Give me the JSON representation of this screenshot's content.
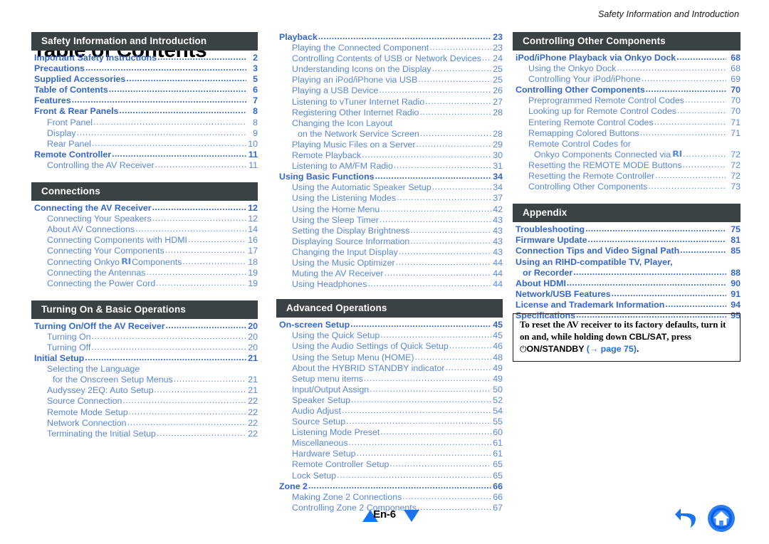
{
  "running_header": "Safety Information and Introduction",
  "page_title": "Table of Contents",
  "columns": [
    {
      "id": "column-1",
      "sections": [
        {
          "header": "Safety Information and Introduction",
          "entries": [
            {
              "level": 1,
              "label": "Important Safety Instructions",
              "page": "2"
            },
            {
              "level": 1,
              "label": "Precautions",
              "page": "3"
            },
            {
              "level": 1,
              "label": "Supplied Accessories",
              "page": "5"
            },
            {
              "level": 1,
              "label": "Table of Contents",
              "page": "6"
            },
            {
              "level": 1,
              "label": "Features",
              "page": "7"
            },
            {
              "level": 1,
              "label": "Front & Rear Panels",
              "page": "8"
            },
            {
              "level": 2,
              "label": "Front Panel",
              "page": "8"
            },
            {
              "level": 2,
              "label": "Display",
              "page": "9"
            },
            {
              "level": 2,
              "label": "Rear Panel",
              "page": "10"
            },
            {
              "level": 1,
              "label": "Remote Controller",
              "page": "11"
            },
            {
              "level": 2,
              "label": "Controlling the AV Receiver",
              "page": "11"
            }
          ]
        },
        {
          "header": "Connections",
          "entries": [
            {
              "level": 1,
              "label": "Connecting the AV Receiver",
              "page": "12"
            },
            {
              "level": 2,
              "label": "Connecting Your Speakers",
              "page": "12"
            },
            {
              "level": 2,
              "label": "About AV Connections",
              "page": "14"
            },
            {
              "level": 2,
              "label": "Connecting Components with HDMI",
              "page": "16"
            },
            {
              "level": 2,
              "label": "Connecting Your Components",
              "page": "17"
            },
            {
              "level": 2,
              "label": "Connecting Onkyo ",
              "logo": "RI",
              "label_after": " Components",
              "page": "18"
            },
            {
              "level": 2,
              "label": "Connecting the Antennas",
              "page": "19"
            },
            {
              "level": 2,
              "label": "Connecting the Power Cord",
              "page": "19"
            }
          ]
        },
        {
          "header": "Turning On & Basic Operations",
          "entries": [
            {
              "level": 1,
              "label": "Turning On/Off the AV Receiver",
              "page": "20"
            },
            {
              "level": 2,
              "label": "Turning On",
              "page": "20"
            },
            {
              "level": 2,
              "label": "Turning Off",
              "page": "20"
            },
            {
              "level": 1,
              "label": "Initial Setup",
              "page": "21"
            },
            {
              "level": 2,
              "label": "Selecting the Language",
              "page": "",
              "nodots": true
            },
            {
              "level": 3,
              "label": "for the Onscreen Setup Menus",
              "page": "21"
            },
            {
              "level": 2,
              "label": "Audyssey 2EQ: Auto Setup",
              "page": "21"
            },
            {
              "level": 2,
              "label": "Source Connection",
              "page": "22"
            },
            {
              "level": 2,
              "label": "Remote Mode Setup",
              "page": "22"
            },
            {
              "level": 2,
              "label": "Network Connection",
              "page": "22"
            },
            {
              "level": 2,
              "label": "Terminating the Initial Setup",
              "page": "22"
            }
          ]
        }
      ]
    },
    {
      "id": "column-2",
      "sections": [
        {
          "header": null,
          "entries": [
            {
              "level": 1,
              "label": "Playback",
              "page": "23"
            },
            {
              "level": 2,
              "label": "Playing the Connected Component",
              "page": "23"
            },
            {
              "level": 2,
              "label": "Controlling Contents of USB or Network Devices",
              "page": "24"
            },
            {
              "level": 2,
              "label": "Understanding Icons on the Display",
              "page": "25"
            },
            {
              "level": 2,
              "label": "Playing an iPod/iPhone via USB",
              "page": "25"
            },
            {
              "level": 2,
              "label": "Playing a USB Device",
              "page": "26"
            },
            {
              "level": 2,
              "label": "Listening to vTuner Internet Radio",
              "page": "27"
            },
            {
              "level": 2,
              "label": "Registering Other Internet Radio",
              "page": "28"
            },
            {
              "level": 2,
              "label": "Changing the Icon Layout",
              "page": "",
              "nodots": true
            },
            {
              "level": 3,
              "label": "on the Network Service Screen",
              "page": "28"
            },
            {
              "level": 2,
              "label": "Playing Music Files on a Server",
              "page": "29"
            },
            {
              "level": 2,
              "label": "Remote Playback",
              "page": "30"
            },
            {
              "level": 2,
              "label": "Listening to AM/FM Radio",
              "page": "31"
            },
            {
              "level": 1,
              "label": "Using Basic Functions",
              "page": "34"
            },
            {
              "level": 2,
              "label": "Using the Automatic Speaker Setup",
              "page": "34"
            },
            {
              "level": 2,
              "label": "Using the Listening Modes",
              "page": "37"
            },
            {
              "level": 2,
              "label": "Using the Home Menu",
              "page": "42"
            },
            {
              "level": 2,
              "label": "Using the Sleep Timer",
              "page": "43"
            },
            {
              "level": 2,
              "label": "Setting the Display Brightness",
              "page": "43"
            },
            {
              "level": 2,
              "label": "Displaying Source Information",
              "page": "43"
            },
            {
              "level": 2,
              "label": "Changing the Input Display",
              "page": "43"
            },
            {
              "level": 2,
              "label": "Using the Music Optimizer",
              "page": "44"
            },
            {
              "level": 2,
              "label": "Muting the AV Receiver",
              "page": "44"
            },
            {
              "level": 2,
              "label": "Using Headphones",
              "page": "44"
            }
          ]
        },
        {
          "header": "Advanced Operations",
          "entries": [
            {
              "level": 1,
              "label": "On-screen Setup",
              "page": "45"
            },
            {
              "level": 2,
              "label": "Using the Quick Setup",
              "page": "45"
            },
            {
              "level": 2,
              "label": "Using the Audio Settings of Quick Setup",
              "page": "46"
            },
            {
              "level": 2,
              "label": "Using the Setup Menu (HOME)",
              "page": "48"
            },
            {
              "level": 2,
              "label": "About the HYBRID STANDBY indicator",
              "page": "49"
            },
            {
              "level": 2,
              "label": "Setup menu items",
              "page": "49"
            },
            {
              "level": 2,
              "label": "Input/Output Assign",
              "page": "50"
            },
            {
              "level": 2,
              "label": "Speaker Setup",
              "page": "52"
            },
            {
              "level": 2,
              "label": "Audio Adjust",
              "page": "54"
            },
            {
              "level": 2,
              "label": "Source Setup",
              "page": "55"
            },
            {
              "level": 2,
              "label": "Listening Mode Preset",
              "page": "60"
            },
            {
              "level": 2,
              "label": "Miscellaneous",
              "page": "61"
            },
            {
              "level": 2,
              "label": "Hardware Setup",
              "page": "61"
            },
            {
              "level": 2,
              "label": "Remote Controller Setup",
              "page": "65"
            },
            {
              "level": 2,
              "label": "Lock Setup",
              "page": "65"
            },
            {
              "level": 1,
              "label": "Zone 2",
              "page": "66"
            },
            {
              "level": 2,
              "label": "Making Zone 2 Connections",
              "page": "66"
            },
            {
              "level": 2,
              "label": "Controlling Zone 2 Components",
              "page": "67"
            }
          ]
        }
      ]
    },
    {
      "id": "column-3",
      "sections": [
        {
          "header": "Controlling Other Components",
          "entries": [
            {
              "level": 1,
              "label": "iPod/iPhone Playback via Onkyo Dock",
              "page": "68"
            },
            {
              "level": 2,
              "label": "Using the Onkyo Dock",
              "page": "68"
            },
            {
              "level": 2,
              "label": "Controlling Your iPod/iPhone",
              "page": "69"
            },
            {
              "level": 1,
              "label": "Controlling Other Components",
              "page": "70"
            },
            {
              "level": 2,
              "label": "Preprogrammed Remote Control Codes",
              "page": "70"
            },
            {
              "level": 2,
              "label": "Looking up for Remote Control Codes",
              "page": "70"
            },
            {
              "level": 2,
              "label": "Entering Remote Control Codes",
              "page": "71"
            },
            {
              "level": 2,
              "label": "Remapping Colored Buttons",
              "page": "71"
            },
            {
              "level": 2,
              "label": "Remote Control Codes for",
              "page": "",
              "nodots": true
            },
            {
              "level": 3,
              "label": "Onkyo Components Connected via ",
              "logo": "RI",
              "label_after": "",
              "page": "72"
            },
            {
              "level": 2,
              "label": "Resetting the REMOTE MODE Buttons",
              "page": "72"
            },
            {
              "level": 2,
              "label": "Resetting the Remote Controller",
              "page": "72"
            },
            {
              "level": 2,
              "label": "Controlling Other Components",
              "page": "73"
            }
          ]
        },
        {
          "header": "Appendix",
          "entries": [
            {
              "level": 1,
              "label": "Troubleshooting",
              "page": "75"
            },
            {
              "level": 1,
              "label": "Firmware Update",
              "page": "81"
            },
            {
              "level": 1,
              "label": "Connection Tips and Video Signal Path",
              "page": "85"
            },
            {
              "level": 1,
              "label": "Using an RIHD-compatible TV, Player,",
              "page": "",
              "nodots": true
            },
            {
              "level": 1,
              "label": "or Recorder",
              "page": "88",
              "indent": true
            },
            {
              "level": 1,
              "label": "About HDMI",
              "page": "90"
            },
            {
              "level": 1,
              "label": "Network/USB Features",
              "page": "91"
            },
            {
              "level": 1,
              "label": "License and Trademark Information",
              "page": "94"
            },
            {
              "level": 1,
              "label": "Specifications",
              "page": "95"
            }
          ]
        }
      ]
    }
  ],
  "note_box": {
    "line1": "To reset the AV receiver to its factory defaults, turn it",
    "line2_pre": "on and, while holding down ",
    "line2_key": "CBL/SAT",
    "line2_post": ", press",
    "line3_power_symbol": "⏻",
    "line3_key": "ON/STANDBY",
    "line3_ref": "(→ page 75)",
    "line3_end": "."
  },
  "footer": {
    "page_label": "En-6",
    "prev_icon": "triangle-up-icon",
    "next_icon": "triangle-down-icon",
    "back_icon": "back-arrow-icon",
    "home_icon": "home-icon"
  },
  "colors": {
    "section_bar_bg": "#3b4245",
    "link_level1": "#3466cf",
    "link_level2": "#5b86e0",
    "nav_blue": "#1a74f0"
  }
}
